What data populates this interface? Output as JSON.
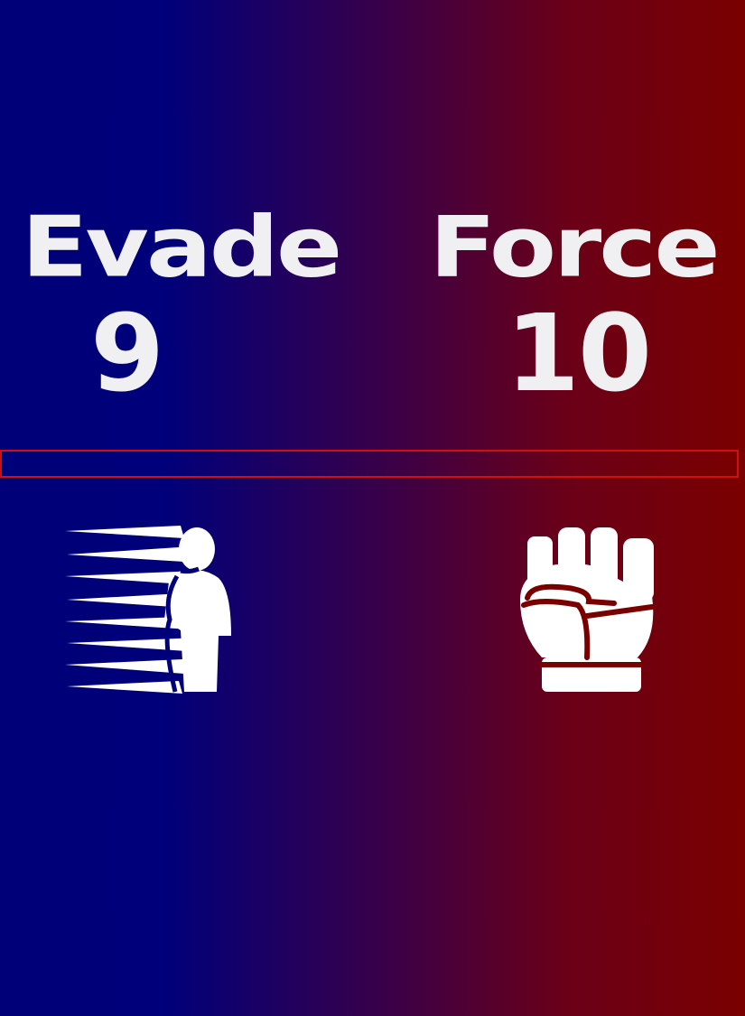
{
  "stats": {
    "evade": {
      "label": "Evade",
      "value": "9",
      "icon": "dodge-icon"
    },
    "force": {
      "label": "Force",
      "value": "10",
      "icon": "fist-icon"
    }
  },
  "colors": {
    "left_background": "#000078",
    "right_background": "#7a0000",
    "text": "#f0f0f2",
    "bar_border": "#d01010"
  },
  "progress": {
    "fraction": 0
  }
}
